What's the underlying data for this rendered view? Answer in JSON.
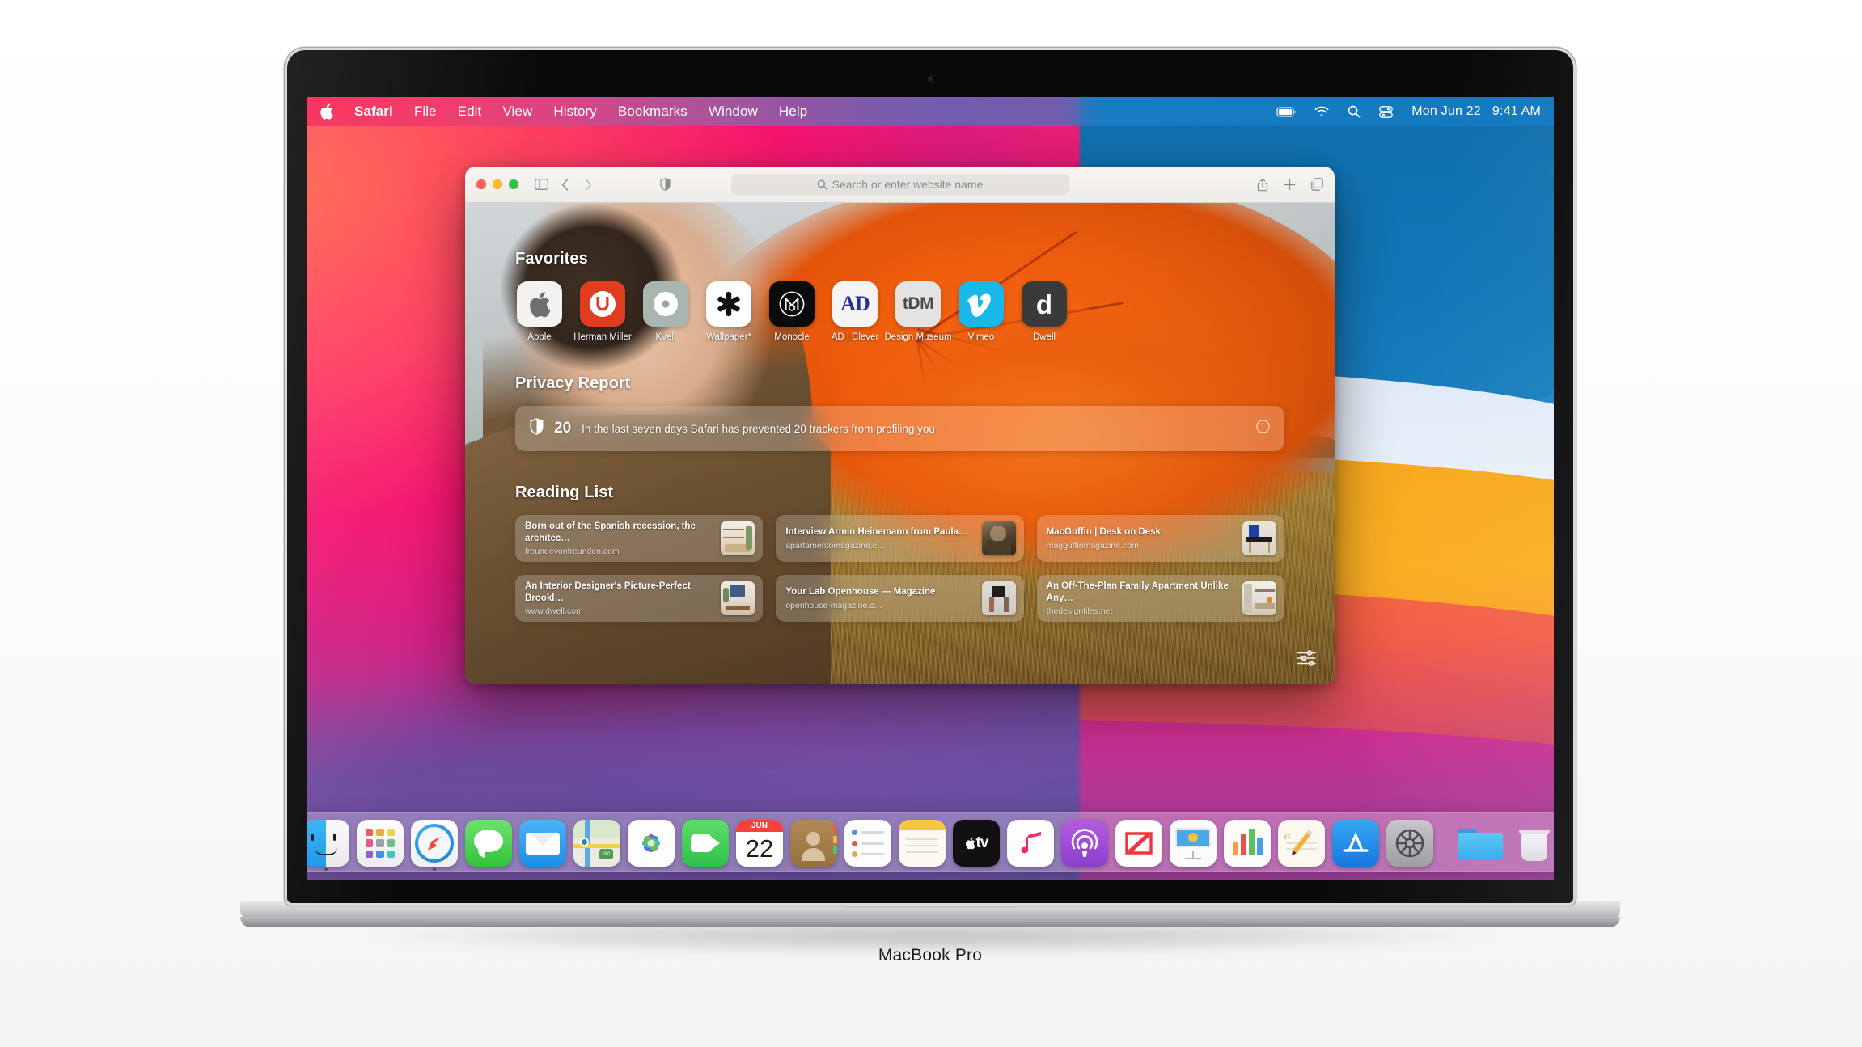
{
  "device": {
    "label": "MacBook Pro"
  },
  "menubar": {
    "apple_icon": "apple-logo-icon",
    "items": [
      {
        "label": "Safari",
        "bold": true
      },
      {
        "label": "File"
      },
      {
        "label": "Edit"
      },
      {
        "label": "View"
      },
      {
        "label": "History"
      },
      {
        "label": "Bookmarks"
      },
      {
        "label": "Window"
      },
      {
        "label": "Help"
      }
    ],
    "status_icons": [
      "battery-icon",
      "wifi-icon",
      "search-icon",
      "control-center-icon"
    ],
    "date": "Mon Jun 22",
    "time": "9:41 AM"
  },
  "safari": {
    "toolbar": {
      "traffic_lights": [
        "close-button",
        "minimize-button",
        "zoom-button"
      ],
      "sidebar_icon": "sidebar-toggle-icon",
      "back_icon": "back-chevron-icon",
      "forward_icon": "forward-chevron-icon",
      "privacy_icon": "privacy-shield-icon",
      "search_icon": "search-icon",
      "address_placeholder": "Search or enter website name",
      "share_icon": "share-icon",
      "new_tab_icon": "plus-icon",
      "tab_overview_icon": "tab-overview-icon"
    },
    "start_page": {
      "favorites_heading": "Favorites",
      "favorites": [
        {
          "label": "Apple",
          "icon": "apple-favicon",
          "bg": "#f2f2f0"
        },
        {
          "label": "Herman Miller",
          "icon": "herman-miller-favicon",
          "bg": "#e03c20"
        },
        {
          "label": "Kvell",
          "icon": "kvell-favicon",
          "bg": "#a9b5ae"
        },
        {
          "label": "Wallpaper*",
          "icon": "wallpaper-favicon",
          "bg": "#ffffff"
        },
        {
          "label": "Monocle",
          "icon": "monocle-favicon",
          "bg": "#0b0b0b"
        },
        {
          "label": "AD | Clever",
          "icon": "ad-favicon",
          "bg": "#f4f4f2"
        },
        {
          "label": "Design Museum",
          "icon": "tdm-favicon",
          "bg": "#e3e3e1"
        },
        {
          "label": "Vimeo",
          "icon": "vimeo-favicon",
          "bg": "#1ab7ea"
        },
        {
          "label": "Dwell",
          "icon": "dwell-favicon",
          "bg": "#3a3a38"
        }
      ],
      "privacy_heading": "Privacy Report",
      "privacy": {
        "shield_icon": "privacy-shield-icon",
        "count": "20",
        "message": "In the last seven days Safari has prevented 20 trackers from profiling you",
        "info_icon": "info-icon"
      },
      "reading_list_heading": "Reading List",
      "reading_list": [
        {
          "title": "Born out of the Spanish recession, the architec…",
          "url": "freundevonfreunden.com",
          "thumb": "interior-shelves-thumb"
        },
        {
          "title": "Interview Armin Heinemann from Paula…",
          "url": "apartamentomagazine.c…",
          "thumb": "portrait-dark-thumb"
        },
        {
          "title": "MacGuffin | Desk on Desk",
          "url": "magguffinmagazine.com",
          "thumb": "blue-desk-thumb"
        },
        {
          "title": "An Interior Designer's Picture-Perfect Brookl…",
          "url": "www.dwell.com",
          "thumb": "living-room-thumb"
        },
        {
          "title": "Your Lab Openhouse — Magazine",
          "url": "openhouse-magazine.c…",
          "thumb": "people-box-thumb"
        },
        {
          "title": "An Off-The-Plan Family Apartment Unlike Any…",
          "url": "thedesignfiles.net",
          "thumb": "kitchen-thumb"
        }
      ],
      "settings_icon": "start-page-settings-icon"
    }
  },
  "dock": {
    "items": [
      {
        "name": "Finder",
        "icon": "finder-icon",
        "running": true
      },
      {
        "name": "Launchpad",
        "icon": "launchpad-icon",
        "running": false
      },
      {
        "name": "Safari",
        "icon": "safari-icon",
        "running": true
      },
      {
        "name": "Messages",
        "icon": "messages-icon",
        "running": false
      },
      {
        "name": "Mail",
        "icon": "mail-icon",
        "running": false
      },
      {
        "name": "Maps",
        "icon": "maps-icon",
        "running": false
      },
      {
        "name": "Photos",
        "icon": "photos-icon",
        "running": false
      },
      {
        "name": "FaceTime",
        "icon": "facetime-icon",
        "running": false
      },
      {
        "name": "Calendar",
        "icon": "calendar-icon",
        "running": false,
        "month": "JUN",
        "day": "22"
      },
      {
        "name": "Contacts",
        "icon": "contacts-icon",
        "running": false
      },
      {
        "name": "Reminders",
        "icon": "reminders-icon",
        "running": false
      },
      {
        "name": "Notes",
        "icon": "notes-icon",
        "running": false
      },
      {
        "name": "TV",
        "icon": "apple-tv-icon",
        "running": false
      },
      {
        "name": "Music",
        "icon": "music-icon",
        "running": false
      },
      {
        "name": "Podcasts",
        "icon": "podcasts-icon",
        "running": false
      },
      {
        "name": "News",
        "icon": "news-icon",
        "running": false
      },
      {
        "name": "Keynote",
        "icon": "keynote-icon",
        "running": false
      },
      {
        "name": "Numbers",
        "icon": "numbers-icon",
        "running": false
      },
      {
        "name": "Pages",
        "icon": "pages-icon",
        "running": false
      },
      {
        "name": "App Store",
        "icon": "app-store-icon",
        "running": false
      },
      {
        "name": "System Preferences",
        "icon": "system-preferences-icon",
        "running": false
      },
      {
        "name": "Downloads",
        "icon": "folder-icon",
        "running": false
      },
      {
        "name": "Trash",
        "icon": "trash-icon",
        "running": false
      }
    ]
  },
  "colors": {
    "accent_orange": "#f5821f",
    "wallpaper_blue": "#1579bd",
    "wallpaper_pink": "#f5146e",
    "dock_glass": "rgba(238,236,245,.30)"
  }
}
